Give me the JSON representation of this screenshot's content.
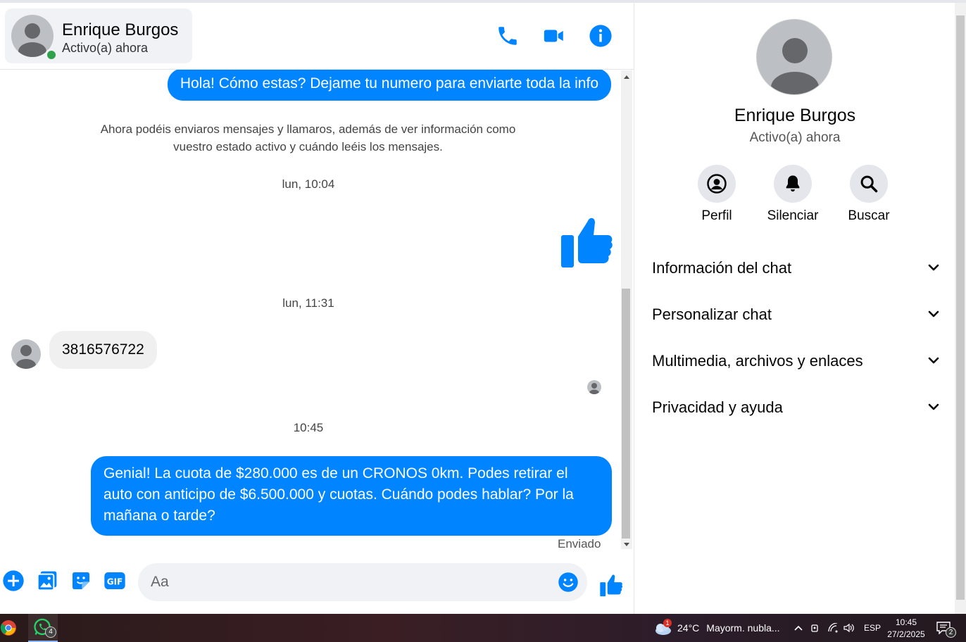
{
  "header": {
    "contact_name": "Enrique Burgos",
    "contact_status": "Activo(a) ahora",
    "icons": [
      "phone-icon",
      "video-icon",
      "info-icon"
    ]
  },
  "messages": {
    "outgoing_1": "Hola! Cómo estas? Dejame tu numero para enviarte toda la info",
    "system_notice_line1": "Ahora podéis enviaros mensajes y llamaros, además de ver información como",
    "system_notice_line2": "vuestro estado activo y cuándo leéis los mensajes.",
    "timestamp_1": "lun, 10:04",
    "timestamp_2": "lun, 11:31",
    "incoming_1": "3816576722",
    "timestamp_3": "10:45",
    "outgoing_2": "Genial! La cuota de $280.000 es de un CRONOS 0km. Podes retirar el auto con anticipo de $6.500.000 y cuotas. Cuándo podes hablar? Por la mañana o tarde?",
    "sent_label": "Enviado"
  },
  "composer": {
    "placeholder": "Aa"
  },
  "info_panel": {
    "name": "Enrique Burgos",
    "status": "Activo(a) ahora",
    "actions": [
      {
        "label": "Perfil",
        "icon": "profile-icon"
      },
      {
        "label": "Silenciar",
        "icon": "bell-icon"
      },
      {
        "label": "Buscar",
        "icon": "search-icon"
      }
    ],
    "sections": [
      {
        "label": "Información del chat"
      },
      {
        "label": "Personalizar chat"
      },
      {
        "label": "Multimedia, archivos y enlaces"
      },
      {
        "label": "Privacidad y ayuda"
      }
    ]
  },
  "taskbar": {
    "whatsapp_badge": "4",
    "weather_badge": "1",
    "temperature": "24°C",
    "weather_text": "Mayorm. nubla...",
    "language": "ESP",
    "time": "10:45",
    "date": "27/2/2025",
    "notifications_count": "2"
  },
  "colors": {
    "accent": "#0084ff",
    "online": "#31a24c",
    "bubble_in": "#f0f0f0"
  }
}
